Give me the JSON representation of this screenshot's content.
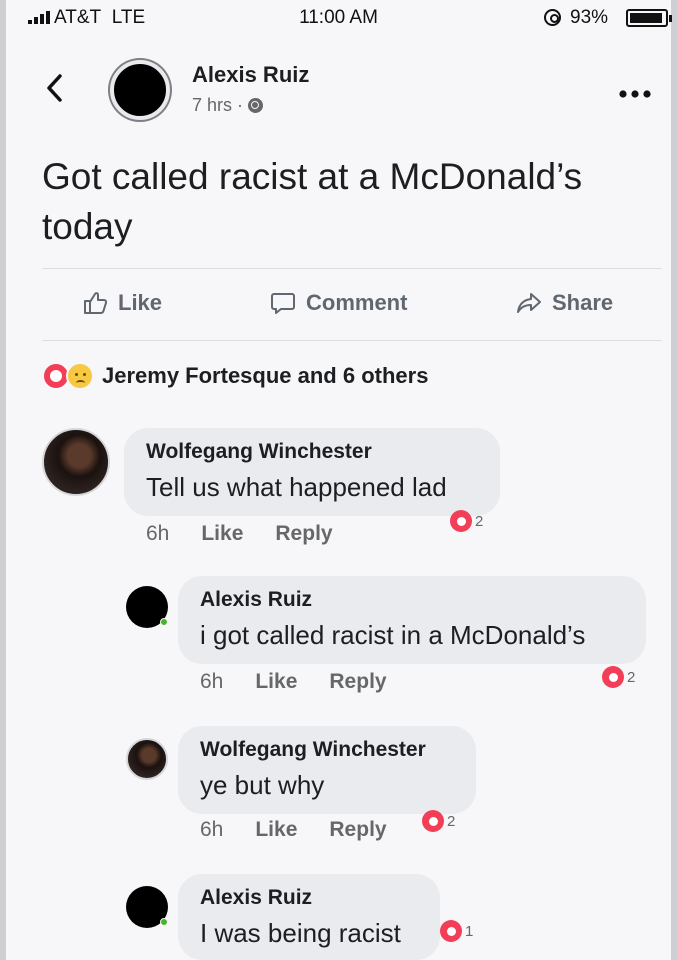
{
  "status_bar": {
    "carrier": "AT&T",
    "network": "LTE",
    "time": "11:00 AM",
    "battery": "93%",
    "battery_level": 0.93
  },
  "post": {
    "author": "Alexis Ruiz",
    "time": "7 hrs",
    "separator": "·",
    "text": "Got called racist at a McDonald’s today",
    "more_icon": "more-options-icon"
  },
  "actions": {
    "like": "Like",
    "comment": "Comment",
    "share": "Share"
  },
  "reactions": {
    "summary": "Jeremy Fortesque and 6 others",
    "types": [
      "love",
      "sad"
    ]
  },
  "comments": [
    {
      "author": "Wolfegang Winchester",
      "text": "Tell us what happened lad",
      "time": "6h",
      "like": "Like",
      "reply": "Reply",
      "reactions": "2",
      "reaction_type": "love"
    },
    {
      "author": "Alexis Ruiz",
      "text": "i got called racist in a McDonald’s",
      "time": "6h",
      "like": "Like",
      "reply": "Reply",
      "reactions": "2",
      "reaction_type": "love"
    },
    {
      "author": "Wolfegang Winchester",
      "text": "ye but why",
      "time": "6h",
      "like": "Like",
      "reply": "Reply",
      "reactions": "2",
      "reaction_type": "love"
    },
    {
      "author": "Alexis Ruiz",
      "text": "I was being racist",
      "reactions": "1",
      "reaction_type": "love"
    }
  ],
  "colors": {
    "love": "#f33e58",
    "sad": "#f7c942",
    "bubble": "#eaebef",
    "online": "#42b72a"
  }
}
